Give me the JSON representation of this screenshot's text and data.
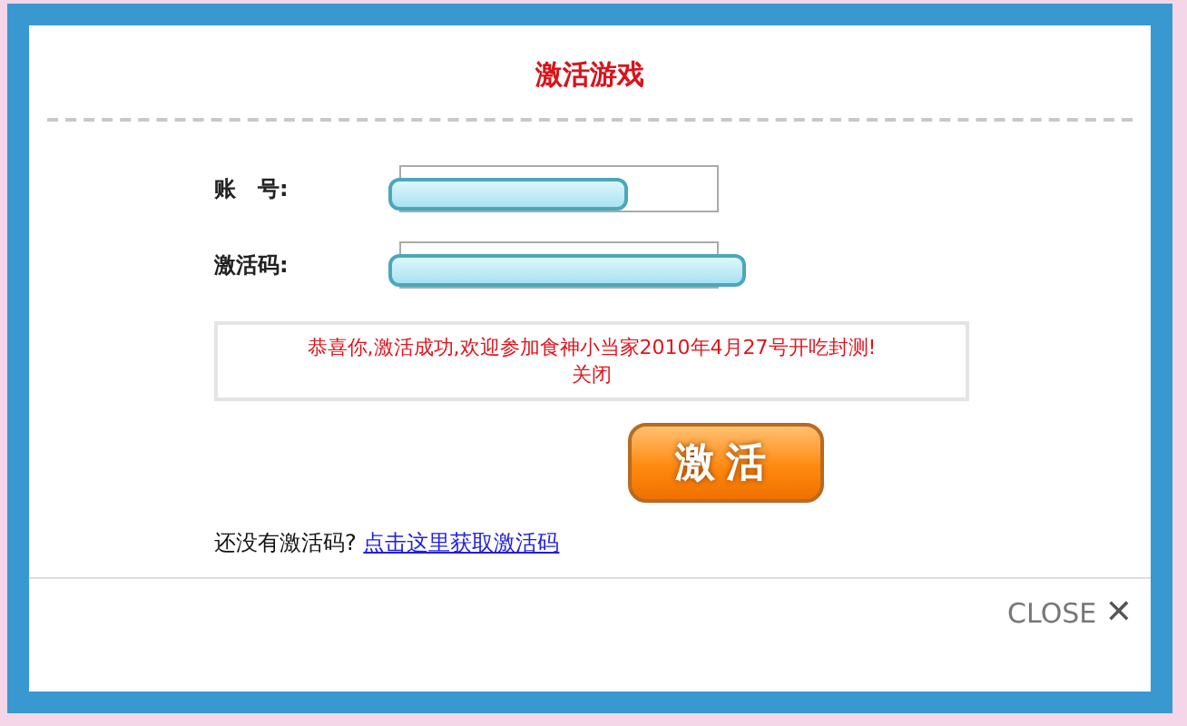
{
  "dialog": {
    "title": "激活游戏"
  },
  "fields": [
    {
      "label": "账　号:",
      "kind": "account"
    },
    {
      "label": "激活码:",
      "kind": "code"
    }
  ],
  "message": {
    "text": "恭喜你,激活成功,欢迎参加食神小当家2010年4月27号开吃封测!",
    "close_link": "关闭"
  },
  "activate_button": "激活",
  "footer": {
    "prompt": "还没有激活码?",
    "link": "点击这里获取激活码"
  },
  "close": {
    "label": "CLOSE",
    "icon": "✕"
  }
}
